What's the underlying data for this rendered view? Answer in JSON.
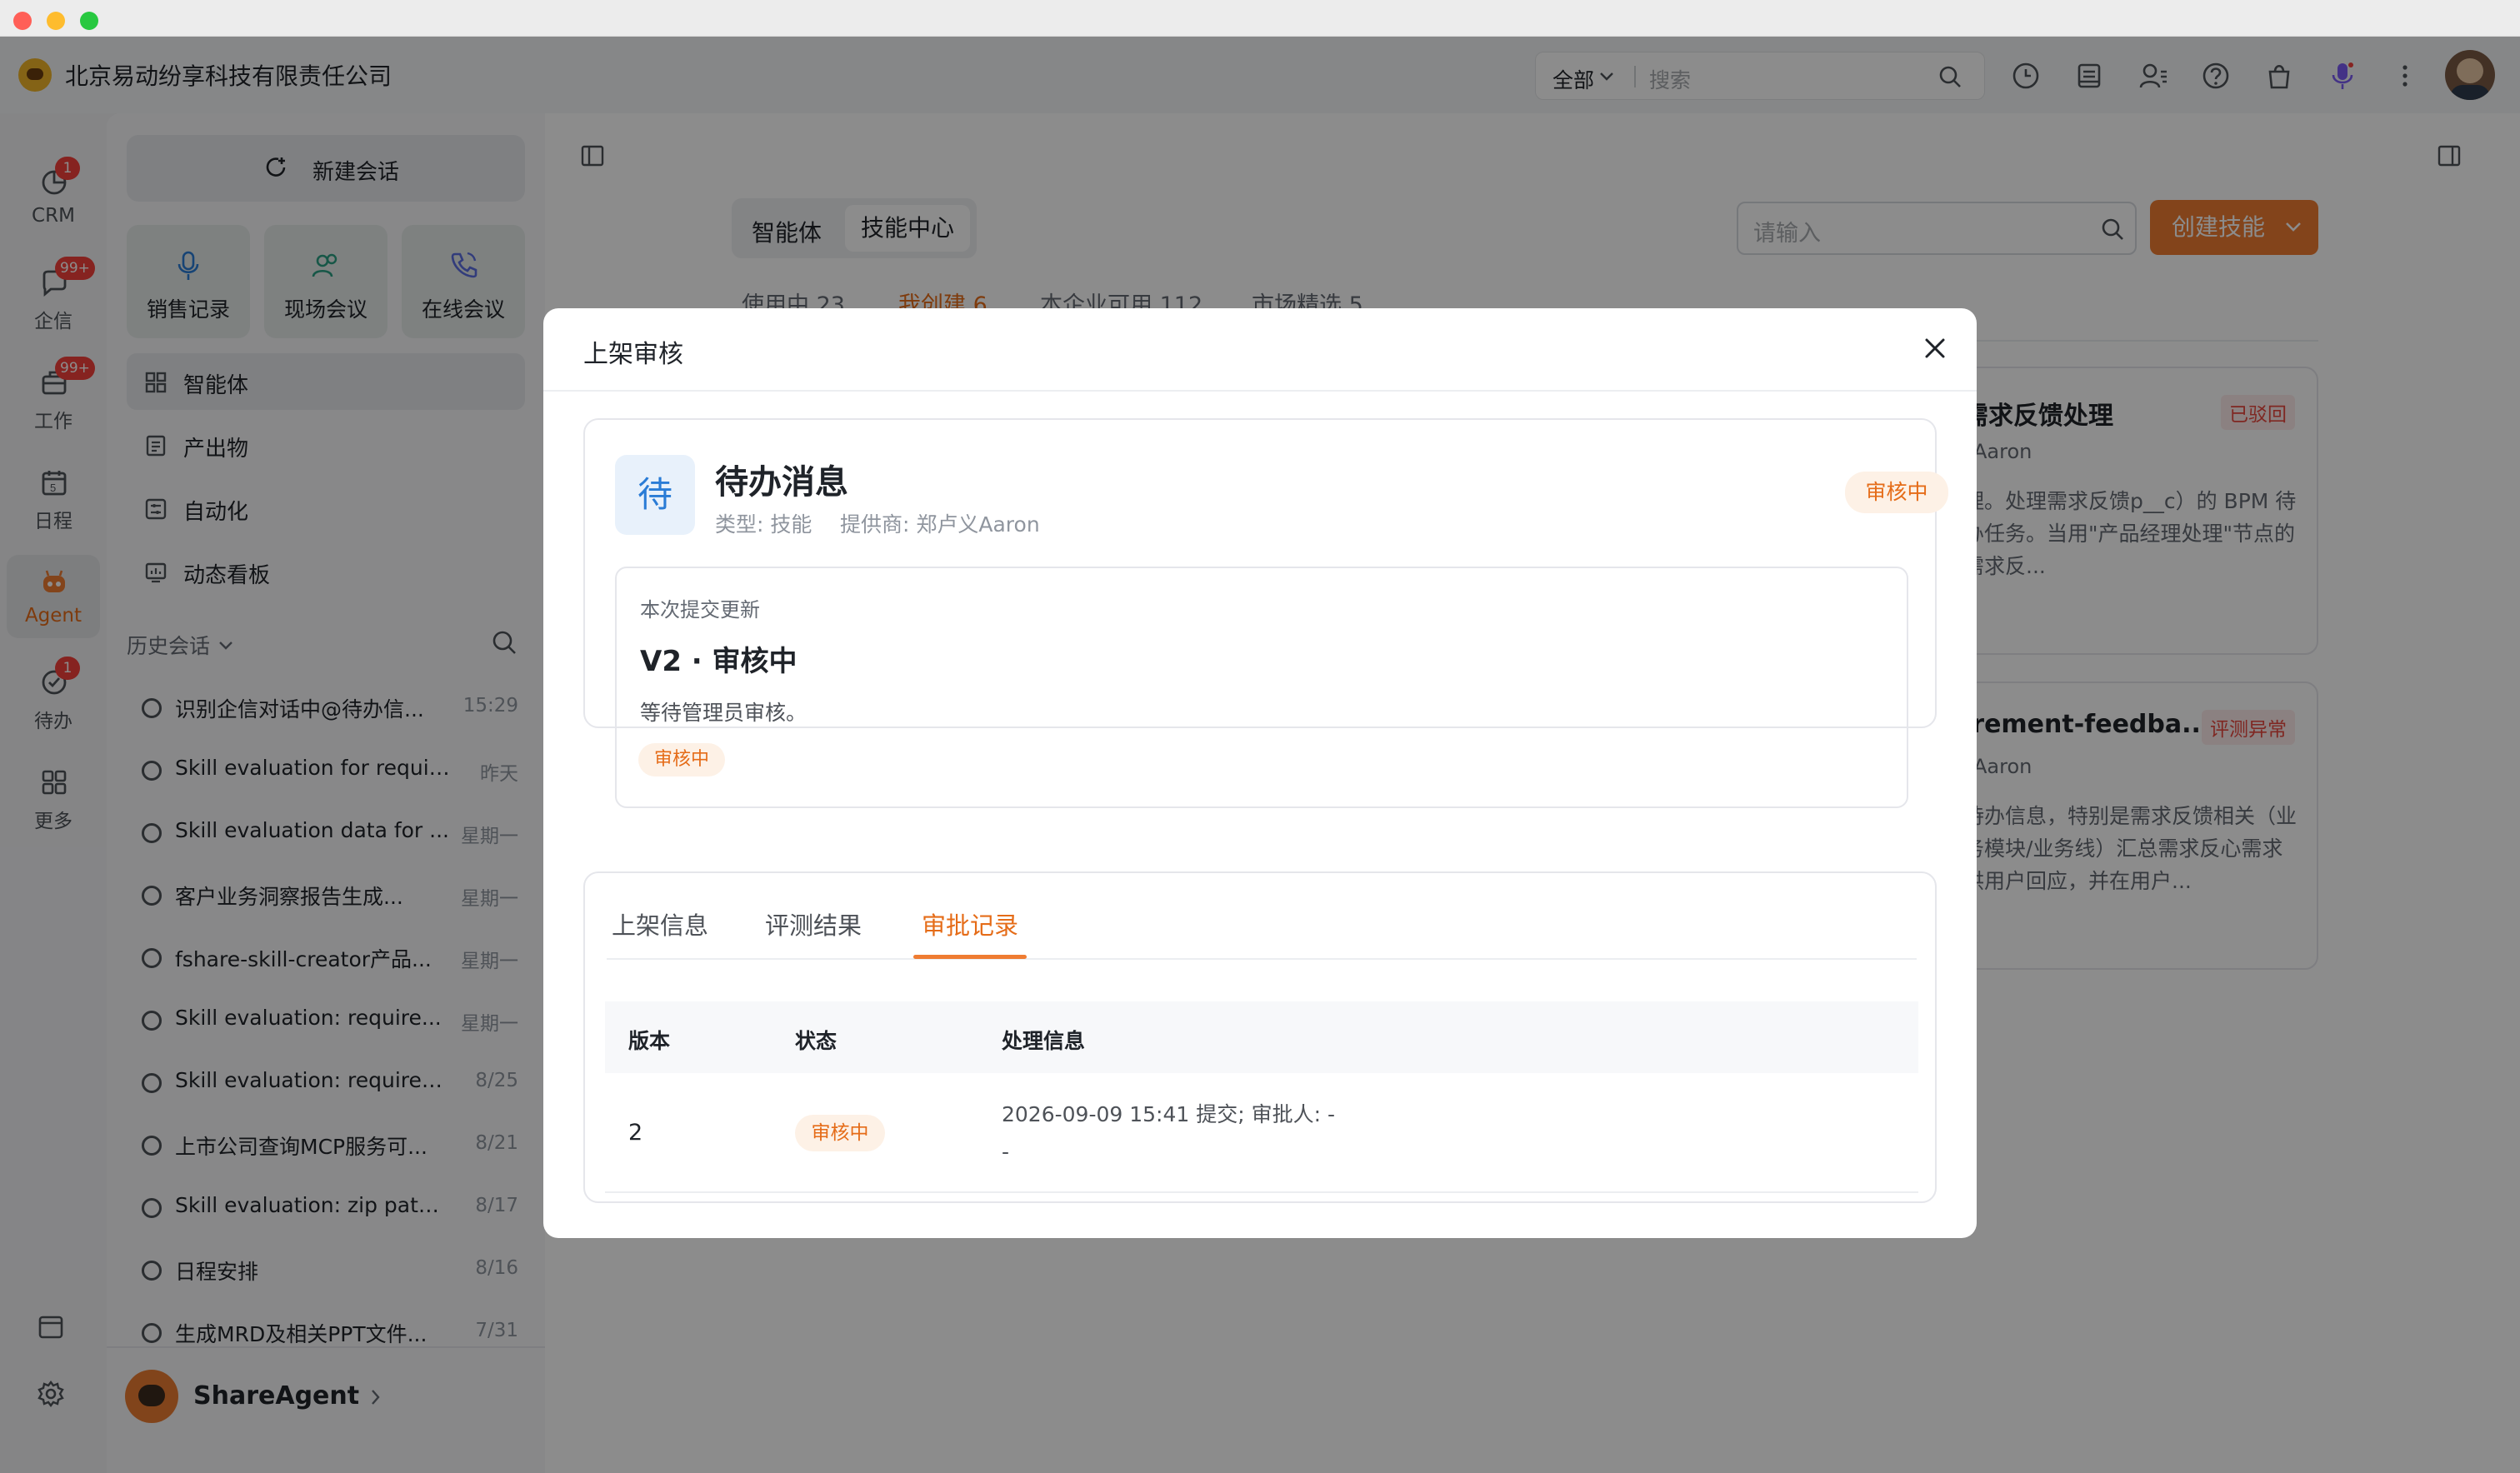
{
  "topbar": {
    "company": "北京易动纷享科技有限责任公司",
    "search_scope": "全部",
    "search_placeholder": "搜索"
  },
  "rail": [
    {
      "label": "CRM",
      "badge": "1",
      "icon": "crm-icon"
    },
    {
      "label": "企信",
      "badge": "99+",
      "icon": "chat-icon"
    },
    {
      "label": "工作",
      "badge": "99+",
      "icon": "work-icon"
    },
    {
      "label": "日程",
      "badge": "",
      "icon": "calendar-icon"
    },
    {
      "label": "Agent",
      "badge": "",
      "icon": "agent-icon"
    },
    {
      "label": "待办",
      "badge": "1",
      "icon": "todo-icon"
    },
    {
      "label": "更多",
      "badge": "",
      "icon": "more-apps-icon"
    }
  ],
  "sidebar": {
    "new_chat": "新建会话",
    "quick": [
      "销售记录",
      "现场会议",
      "在线会议"
    ],
    "menu": [
      "智能体",
      "产出物",
      "自动化",
      "动态看板"
    ],
    "history_title": "历史会话",
    "history": [
      {
        "title": "识别企信对话中@待办信...",
        "date": "15:29"
      },
      {
        "title": "Skill evaluation for require...",
        "date": "昨天"
      },
      {
        "title": "Skill evaluation data for ...",
        "date": "星期一"
      },
      {
        "title": "客户业务洞察报告生成...",
        "date": "星期一"
      },
      {
        "title": "fshare-skill-creator产品...",
        "date": "星期一"
      },
      {
        "title": "Skill evaluation: require...",
        "date": "星期一"
      },
      {
        "title": "Skill evaluation: requireme...",
        "date": "8/25"
      },
      {
        "title": "上市公司查询MCP服务可...",
        "date": "8/21"
      },
      {
        "title": "Skill evaluation: zip path a...",
        "date": "8/17"
      },
      {
        "title": "日程安排",
        "date": "8/16"
      },
      {
        "title": "生成MRD及相关PPT文件...",
        "date": "7/31"
      }
    ],
    "user_name": "ShareAgent"
  },
  "main": {
    "seg_agent": "智能体",
    "seg_skill": "技能中心",
    "search_placeholder": "请输入",
    "create_btn": "创建技能",
    "tabs": [
      "使用中 23",
      "我创建 6",
      "本企业可用 112",
      "市场精选 5"
    ],
    "cards": [
      {
        "title": "需求反馈处理",
        "tag": "已驳回",
        "sub": "_Aaron",
        "desc": "理。处理需求反馈p__c）的 BPM 待办任务。当用\"产品经理处理\"节点的需求反..."
      },
      {
        "title": "irement-feedba...",
        "tag": "评测异常",
        "sub": "_Aaron",
        "desc": "待办信息，特别是需求反馈相关（业务模块/业务线）汇总需求反心需求供用户回应，并在用户..."
      }
    ]
  },
  "modal": {
    "title": "上架审核",
    "icon_char": "待",
    "skill_name": "待办消息",
    "type_label": "类型: 技能",
    "provider_label": "提供商: 郑卢义Aaron",
    "status": "审核中",
    "update_label": "本次提交更新",
    "version_title": "V2 · 审核中",
    "update_desc": "等待管理员审核。",
    "update_status": "审核中",
    "tabs": [
      "上架信息",
      "评测结果",
      "审批记录"
    ],
    "active_tab": "审批记录",
    "table": {
      "headers": [
        "版本",
        "状态",
        "处理信息"
      ],
      "rows": [
        {
          "version": "2",
          "status": "审核中",
          "info_line1": "2026-09-09 15:41 提交; 审批人: -",
          "info_line2": "-"
        }
      ]
    }
  },
  "colors": {
    "accent": "#ef7c32",
    "danger": "#e8473f",
    "badge": "#f5413b",
    "icon_blue": "#2a7cd6"
  }
}
